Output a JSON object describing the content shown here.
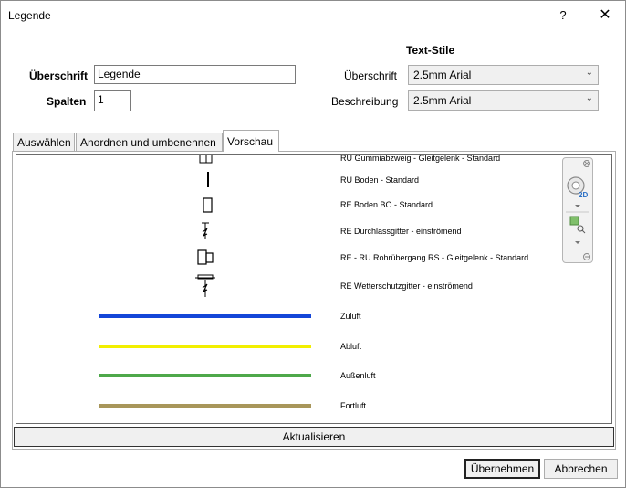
{
  "window": {
    "title": "Legende",
    "help_label": "?",
    "close_label": "✕"
  },
  "form": {
    "heading_label": "Überschrift",
    "heading_value": "Legende",
    "columns_label": "Spalten",
    "columns_value": "1"
  },
  "text_styles": {
    "section_title": "Text-Stile",
    "heading_label": "Überschrift",
    "heading_value": "2.5mm Arial",
    "description_label": "Beschreibung",
    "description_value": "2.5mm Arial"
  },
  "tabs": [
    {
      "label": "Auswählen"
    },
    {
      "label": "Anordnen und umbenennen"
    },
    {
      "label": "Vorschau",
      "active": true
    }
  ],
  "preview": {
    "items": [
      {
        "label": "RU Gummiabzweig - Gleitgelenk - Standard"
      },
      {
        "label": "RU Boden - Standard"
      },
      {
        "label": "RE Boden BO - Standard"
      },
      {
        "label": "RE Durchlassgitter - einströmend"
      },
      {
        "label": "RE - RU Rohrübergang RS - Gleitgelenk - Standard"
      },
      {
        "label": "RE Wetterschutzgitter - einströmend"
      },
      {
        "label": "Zuluft",
        "color": "#1446d8"
      },
      {
        "label": "Abluft",
        "color": "#f2ef00"
      },
      {
        "label": "Außenluft",
        "color": "#4ea84a"
      },
      {
        "label": "Fortluft",
        "color": "#a8965a"
      }
    ],
    "nav_icons": [
      "navbar-close-icon",
      "steering-wheel-2d-icon",
      "zoom-icon"
    ]
  },
  "buttons": {
    "refresh": "Aktualisieren",
    "apply": "Übernehmen",
    "cancel": "Abbrechen"
  }
}
